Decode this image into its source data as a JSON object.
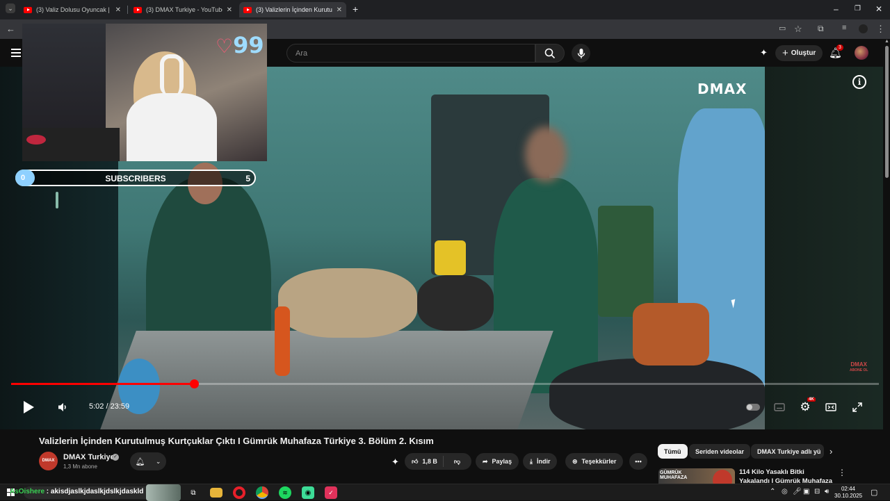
{
  "tabs": [
    {
      "title": "(3) Valiz Dolusu Oyuncak | Gümrü",
      "active": false
    },
    {
      "title": "(3) DMAX Turkiye - YouTube",
      "active": false
    },
    {
      "title": "(3) Valizlerin İçinden Kurutulmuş",
      "active": true
    }
  ],
  "masthead": {
    "search_placeholder": "Ara",
    "create_label": "Oluştur",
    "notification_count": "3"
  },
  "player": {
    "watermark": "DMAX",
    "corner_watermark_line1": "DMAX",
    "corner_watermark_line2": "ABONE OL",
    "time": "5:02 / 23:59",
    "progress_fraction": 0.211,
    "quality_badge": "4K"
  },
  "overlay": {
    "heart_counter": "99",
    "subs_current": "0",
    "subs_label": "SUBSCRIBERS",
    "subs_goal": "5"
  },
  "video": {
    "title": "Valizlerin İçinden Kurutulmuş Kurtçuklar Çıktı I Gümrük Muhafaza Türkiye 3. Bölüm 2. Kısım",
    "channel_name": "DMAX Turkiye",
    "channel_avatar_text": "DMAX",
    "subscribers": "1,3 Mn abone",
    "like_count": "1,8 B",
    "share_label": "Paylaş",
    "download_label": "İndir",
    "thanks_label": "Teşekkürler"
  },
  "chips": [
    "Tümü",
    "Seriden videolar",
    "DMAX Turkiye adlı yü"
  ],
  "recommendation": {
    "thumb_label_line1": "GÜMRÜK",
    "thumb_label_line2": "MUHAFAZA",
    "title": "114 Kilo Yasaklı Bitki Yakalandı I Gümrük Muhafaza Türkiye 5..."
  },
  "taskbar": {
    "chat_user": "AsOishere",
    "chat_message": " : akisdjaslkjdaslkjdslkjdaskld",
    "time": "02:44",
    "date": "30.10.2025"
  },
  "colors": {
    "accent_red": "#ff0000",
    "subs_fill": "#8ed0ff",
    "chat_user": "#39d353"
  }
}
